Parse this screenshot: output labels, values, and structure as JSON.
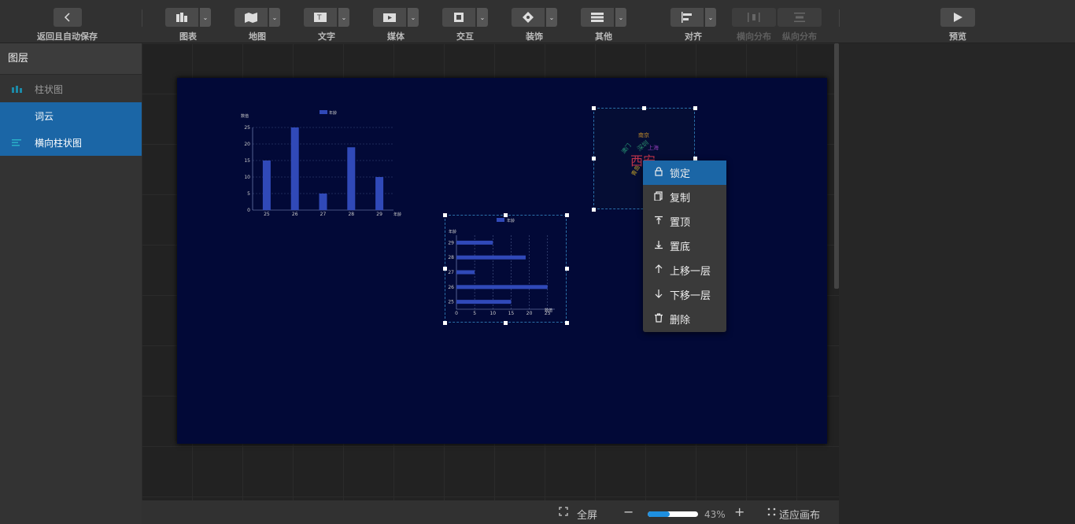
{
  "toolbar": {
    "back_label": "返回且自动保存",
    "items": [
      {
        "label": "图表",
        "icon": "chart-icon"
      },
      {
        "label": "地图",
        "icon": "map-icon"
      },
      {
        "label": "文字",
        "icon": "text-icon"
      },
      {
        "label": "媒体",
        "icon": "media-icon"
      },
      {
        "label": "交互",
        "icon": "interaction-icon"
      },
      {
        "label": "装饰",
        "icon": "decoration-icon"
      },
      {
        "label": "其他",
        "icon": "other-icon"
      }
    ],
    "align_label": "对齐",
    "hdist_label": "横向分布",
    "vdist_label": "纵向分布",
    "preview_label": "预览"
  },
  "layers": {
    "title": "图层",
    "items": [
      {
        "label": "柱状图",
        "icon": "bar-chart-icon",
        "selected": false
      },
      {
        "label": "词云",
        "icon": "",
        "selected": true
      },
      {
        "label": "横向柱状图",
        "icon": "hbar-chart-icon",
        "selected": true
      }
    ]
  },
  "context_menu": {
    "items": [
      {
        "label": "锁定",
        "icon": "lock-icon"
      },
      {
        "label": "复制",
        "icon": "copy-icon"
      },
      {
        "label": "置顶",
        "icon": "bring-to-top-icon"
      },
      {
        "label": "置底",
        "icon": "send-to-bottom-icon"
      },
      {
        "label": "上移一层",
        "icon": "arrow-up-icon"
      },
      {
        "label": "下移一层",
        "icon": "arrow-down-icon"
      },
      {
        "label": "删除",
        "icon": "trash-icon"
      }
    ]
  },
  "bottom": {
    "fullscreen_label": "全屏",
    "zoom": "43%",
    "zoom_fraction": 0.43,
    "fit_label": "适应画布"
  },
  "chart_data": [
    {
      "type": "bar",
      "legend": "年龄",
      "ylabel": "数值",
      "xlabel": "年龄",
      "categories": [
        "25",
        "26",
        "27",
        "28",
        "29"
      ],
      "values": [
        15,
        25,
        5,
        19,
        10
      ],
      "yticks": [
        0,
        5,
        10,
        15,
        20,
        25
      ],
      "ylim": [
        0,
        25
      ],
      "color": "#3049b8"
    },
    {
      "type": "bar",
      "orientation": "horizontal",
      "legend": "年龄",
      "ylabel": "年龄",
      "xlabel": "数值",
      "categories": [
        "29",
        "28",
        "27",
        "26",
        "25"
      ],
      "values": [
        10,
        19,
        5,
        25,
        15
      ],
      "xticks": [
        0,
        5,
        10,
        15,
        20,
        25
      ],
      "xlim": [
        0,
        27
      ],
      "color": "#3049b8"
    }
  ],
  "wordcloud": {
    "words": [
      {
        "text": "西安",
        "color": "#c0344a"
      },
      {
        "text": "南京",
        "color": "#c08a2a"
      },
      {
        "text": "深圳",
        "color": "#2a8a6a"
      },
      {
        "text": "澳门",
        "color": "#2aa07a"
      },
      {
        "text": "上海",
        "color": "#8a3ab0"
      },
      {
        "text": "青岛",
        "color": "#c0a02a"
      }
    ]
  }
}
